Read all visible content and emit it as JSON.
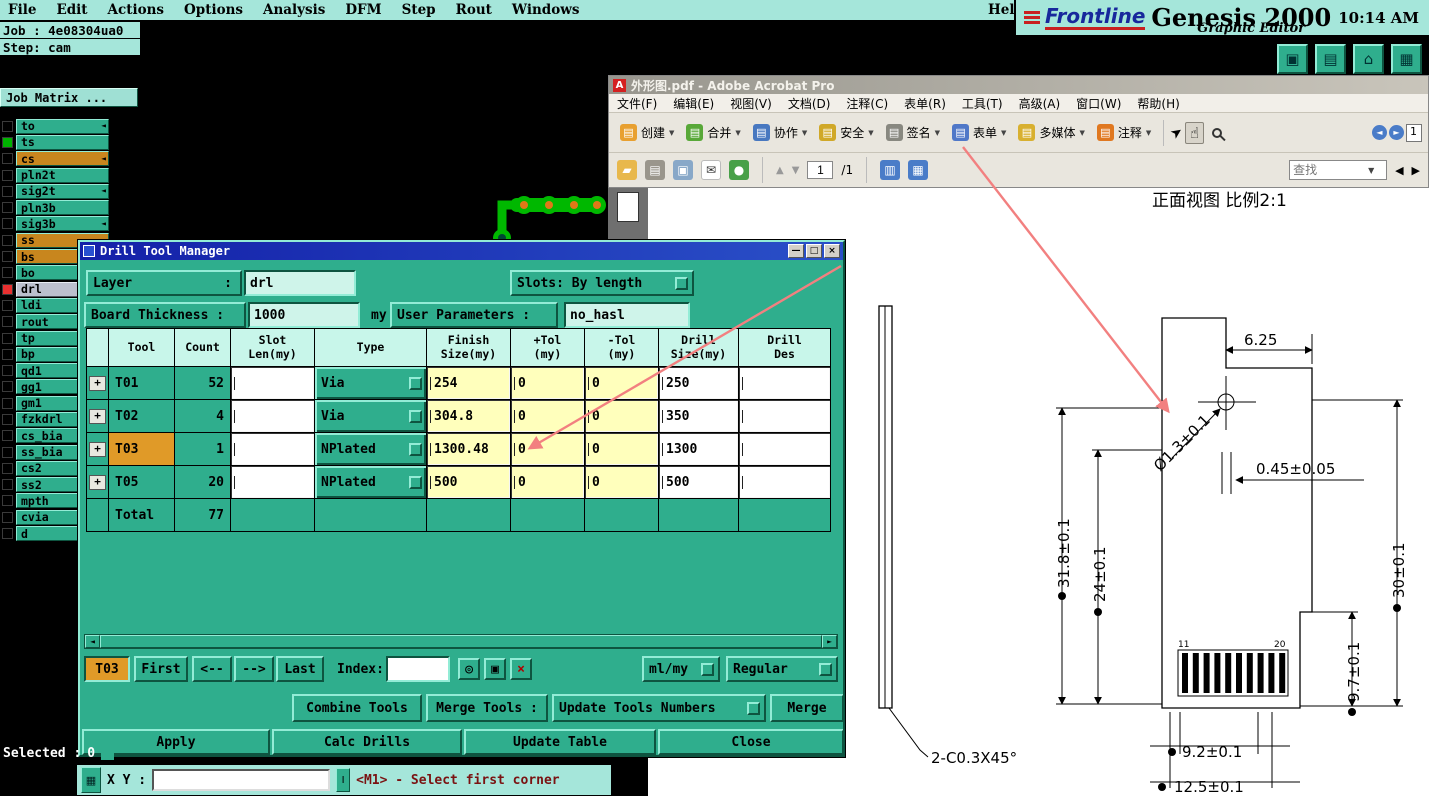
{
  "genesis": {
    "menu": [
      "File",
      "Edit",
      "Actions",
      "Options",
      "Analysis",
      "DFM",
      "Step",
      "Rout",
      "Windows"
    ],
    "help": "Help",
    "brand": {
      "logo": "Frontline",
      "product": "Genesis 2000",
      "edition": "Graphic Editor",
      "time": "10:14 AM"
    },
    "job": {
      "job_line": "Job : 4e08304ua0",
      "step_line": "Step: cam",
      "job_matrix": "Job Matrix ..."
    },
    "layers": [
      {
        "name": "to",
        "arrow": true
      },
      {
        "name": "ts",
        "square": "#00B400"
      },
      {
        "name": "cs",
        "bg": "#C8861E",
        "arrow": true
      },
      {
        "name": "pln2t"
      },
      {
        "name": "sig2t",
        "arrow": true
      },
      {
        "name": "pln3b"
      },
      {
        "name": "sig3b",
        "arrow": true
      },
      {
        "name": "ss",
        "bg": "#C8861E"
      },
      {
        "name": "bs",
        "bg": "#C8861E"
      },
      {
        "name": "bo"
      },
      {
        "name": "drl",
        "selected": true,
        "square": "#E83030"
      },
      {
        "name": "ldi"
      },
      {
        "name": "rout"
      },
      {
        "name": "tp"
      },
      {
        "name": "bp"
      },
      {
        "name": "qd1"
      },
      {
        "name": "gg1"
      },
      {
        "name": "gm1"
      },
      {
        "name": "fzkdrl"
      },
      {
        "name": "cs_bia"
      },
      {
        "name": "ss_bia"
      },
      {
        "name": "cs2"
      },
      {
        "name": "ss2"
      },
      {
        "name": "mpth"
      },
      {
        "name": "cvia"
      },
      {
        "name": "d"
      }
    ],
    "status": {
      "selected_label": "Selected :",
      "selected_value": "0",
      "xy_label": "X Y :",
      "xy_value": "",
      "prompt": "<M1> - Select first corner"
    }
  },
  "dialog": {
    "title": "Drill Tool Manager",
    "layer_label": "Layer",
    "layer_colon": ":",
    "layer_value": "drl",
    "slots_label": "Slots: By length",
    "thickness_label": "Board Thickness :",
    "thickness_value": "1000",
    "thickness_unit": "my",
    "user_params_label": "User Parameters :",
    "user_params_value": "no_hasl",
    "table": {
      "headers": [
        "",
        "Tool",
        "Count",
        "Slot\nLen(my)",
        "Type",
        "Finish\nSize(my)",
        "+Tol\n(my)",
        "-Tol\n(my)",
        "Drill\nSize(my)",
        "Drill\nDes"
      ],
      "rows": [
        {
          "tool": "T01",
          "count": "52",
          "slot_len": "",
          "type": "Via",
          "finish": "254",
          "plus_tol": "0",
          "minus_tol": "0",
          "drill": "250",
          "des": ""
        },
        {
          "tool": "T02",
          "count": "4",
          "slot_len": "",
          "type": "Via",
          "finish": "304.8",
          "plus_tol": "0",
          "minus_tol": "0",
          "drill": "350",
          "des": ""
        },
        {
          "tool": "T03",
          "count": "1",
          "slot_len": "",
          "type": "NPlated",
          "finish": "1300.48",
          "plus_tol": "0",
          "minus_tol": "0",
          "drill": "1300",
          "des": "",
          "highlight": true
        },
        {
          "tool": "T05",
          "count": "20",
          "slot_len": "",
          "type": "NPlated",
          "finish": "500",
          "plus_tol": "0",
          "minus_tol": "0",
          "drill": "500",
          "des": ""
        }
      ],
      "total_label": "Total",
      "total_count": "77"
    },
    "nav": {
      "current": "T03",
      "first": "First",
      "prev": "<--",
      "next": "-->",
      "last": "Last",
      "index_label": "Index:",
      "index_value": "",
      "units": "ml/my",
      "mode": "Regular"
    },
    "actions": {
      "combine": "Combine Tools",
      "merge_tools": "Merge Tools :",
      "update_numbers": "Update Tools Numbers",
      "merge": "Merge",
      "apply": "Apply",
      "calc_drills": "Calc Drills",
      "update_table": "Update Table",
      "close": "Close"
    }
  },
  "acrobat": {
    "title": "外形图.pdf - Adobe Acrobat Pro",
    "menu": [
      "文件(F)",
      "编辑(E)",
      "视图(V)",
      "文档(D)",
      "注释(C)",
      "表单(R)",
      "工具(T)",
      "高级(A)",
      "窗口(W)",
      "帮助(H)"
    ],
    "toolbar": [
      "创建",
      "合并",
      "协作",
      "安全",
      "签名",
      "表单",
      "多媒体",
      "注释"
    ],
    "page_value": "1",
    "page_total": "/1",
    "find_placeholder": "查找"
  },
  "drawing": {
    "view_title": "正面视图 比例2:1",
    "dim_width_top": "6.25",
    "dim_hole": "Ø1.3±0.1",
    "dim_offset": "0.45±0.05",
    "dim_h1": "31.8±0.1",
    "dim_h2": "24±0.1",
    "dim_h3": "30±0.1",
    "dim_h4": "9.7±0.1",
    "dim_w1": "9.2±0.1",
    "dim_w2": "12.5±0.1",
    "chamfer": "2-C0.3X45°",
    "pin_start": "11",
    "pin_end": "20"
  },
  "colors": {
    "accent_teal": "#2FAE8D",
    "highlight_orange": "#E09A28",
    "annotation_red": "#F28080"
  }
}
